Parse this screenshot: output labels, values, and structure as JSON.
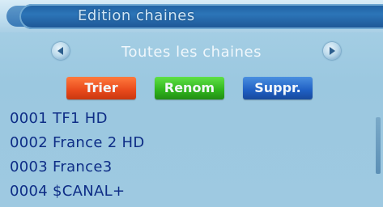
{
  "header": {
    "title": "Edition chaines"
  },
  "navigation": {
    "label": "Toutes les chaines",
    "left_icon": "left-arrow-icon",
    "right_icon": "right-arrow-icon"
  },
  "actions": {
    "sort_label": "Trier",
    "rename_label": "Renom",
    "delete_label": "Suppr."
  },
  "channels": [
    {
      "number": "0001",
      "name": "TF1 HD"
    },
    {
      "number": "0002",
      "name": "France 2 HD"
    },
    {
      "number": "0003",
      "name": "France3"
    },
    {
      "number": "0004",
      "name": "$CANAL+"
    }
  ],
  "colors": {
    "sort_button": "#e8491b",
    "rename_button": "#2fb41c",
    "delete_button": "#1f5fc3",
    "channel_text": "#0e2d86"
  }
}
